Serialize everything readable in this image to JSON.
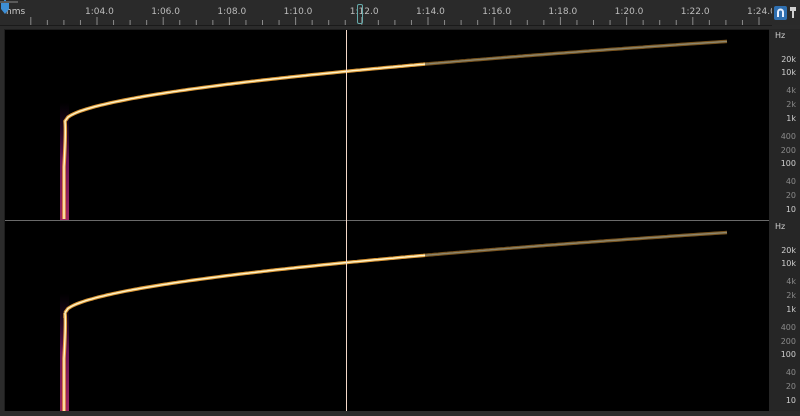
{
  "ruler": {
    "units": "hms",
    "ticks": [
      "1:04.0",
      "1:06.0",
      "1:08.0",
      "1:10.0",
      "1:12.0",
      "1:14.0",
      "1:16.0",
      "1:18.0",
      "1:20.0",
      "1:22.0",
      "1:24.0"
    ],
    "playhead_label": "1:12.0",
    "playhead_visible_label": ":2.0"
  },
  "toolbar": {
    "snap_icon": "magnet-icon",
    "pin_icon": "pin-icon"
  },
  "channels": [
    {
      "unit": "Hz",
      "freq_labels": [
        {
          "text": "20k",
          "dim": false
        },
        {
          "text": "10k",
          "dim": false
        },
        {
          "text": "4k",
          "dim": true
        },
        {
          "text": "2k",
          "dim": true
        },
        {
          "text": "1k",
          "dim": false
        },
        {
          "text": "400",
          "dim": true
        },
        {
          "text": "200",
          "dim": true
        },
        {
          "text": "100",
          "dim": false
        },
        {
          "text": "40",
          "dim": true
        },
        {
          "text": "20",
          "dim": true
        },
        {
          "text": "10",
          "dim": false
        }
      ]
    },
    {
      "unit": "Hz",
      "freq_labels": [
        {
          "text": "20k",
          "dim": false
        },
        {
          "text": "10k",
          "dim": false
        },
        {
          "text": "4k",
          "dim": true
        },
        {
          "text": "2k",
          "dim": true
        },
        {
          "text": "1k",
          "dim": false
        },
        {
          "text": "400",
          "dim": true
        },
        {
          "text": "200",
          "dim": true
        },
        {
          "text": "100",
          "dim": false
        },
        {
          "text": "40",
          "dim": true
        },
        {
          "text": "20",
          "dim": true
        },
        {
          "text": "10",
          "dim": false
        }
      ]
    }
  ],
  "colors": {
    "playhead": "#f2d7c8",
    "accent": "#3d8fd6",
    "sweep_core": "#fff4c8",
    "sweep_warm": "#ffb040",
    "sweep_magenta": "#b02a6a"
  }
}
